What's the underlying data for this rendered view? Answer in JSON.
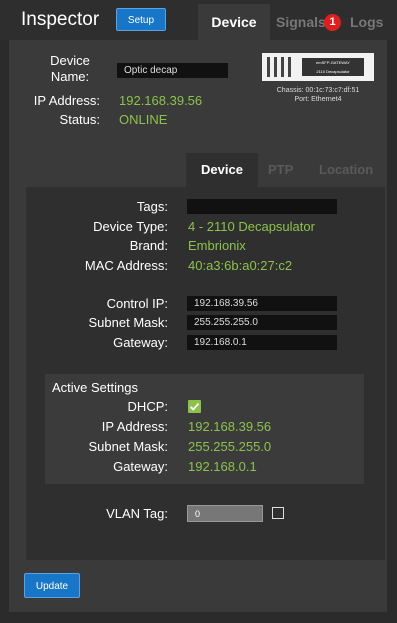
{
  "app": {
    "title": "Inspector",
    "setup_label": "Setup"
  },
  "main_tabs": [
    {
      "label": "Device",
      "active": true
    },
    {
      "label": "Signals",
      "badge": "1"
    },
    {
      "label": "Logs"
    }
  ],
  "device": {
    "name_label": "Device Name:",
    "name_value": "Optic decap",
    "ip_label": "IP Address:",
    "ip_value": "192.168.39.56",
    "status_label": "Status:",
    "status_value": "ONLINE",
    "image_label": "emSFP-GATEWAY",
    "image_sublabel": "2110 Decapsulator",
    "chassis": "Chassis: 00:1c:73:c7:df:51",
    "port": "Port: Ethernet4"
  },
  "sub_tabs": [
    {
      "label": "Device",
      "active": true
    },
    {
      "label": "PTP"
    },
    {
      "label": "Location"
    }
  ],
  "details": {
    "tags_label": "Tags:",
    "tags_value": "",
    "type_label": "Device Type:",
    "type_value": "4 - 2110 Decapsulator",
    "brand_label": "Brand:",
    "brand_value": "Embrionix",
    "mac_label": "MAC Address:",
    "mac_value": "40:a3:6b:a0:27:c2",
    "control_ip_label": "Control IP:",
    "control_ip_value": "192.168.39.56",
    "subnet_label": "Subnet Mask:",
    "subnet_value": "255.255.255.0",
    "gateway_label": "Gateway:",
    "gateway_value": "192.168.0.1"
  },
  "active_settings": {
    "title": "Active Settings",
    "dhcp_label": "DHCP:",
    "dhcp_checked": true,
    "ip_label": "IP Address:",
    "ip_value": "192.168.39.56",
    "subnet_label": "Subnet Mask:",
    "subnet_value": "255.255.255.0",
    "gateway_label": "Gateway:",
    "gateway_value": "192.168.0.1"
  },
  "vlan": {
    "label": "VLAN Tag:",
    "value": "0",
    "checked": false
  },
  "update_label": "Update",
  "colors": {
    "accent": "#1876c8",
    "value_green": "#8bc34a",
    "badge_red": "#e01e1e"
  }
}
